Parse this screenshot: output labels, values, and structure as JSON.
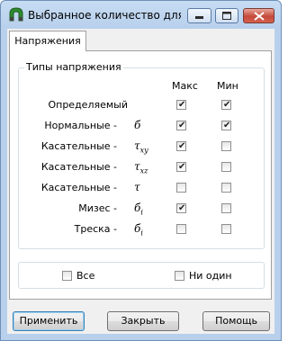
{
  "window": {
    "title": "Выбранное количество для п..."
  },
  "tabs": [
    {
      "label": "Напряжения"
    }
  ],
  "stress_group": {
    "title": "Типы напряжения",
    "col_max": "Макс",
    "col_min": "Мин",
    "rows": [
      {
        "label": "Определяемый",
        "symbol": "",
        "sub": "",
        "max": true,
        "min": true
      },
      {
        "label": "Нормальные -",
        "symbol": "б",
        "sub": "",
        "max": true,
        "min": true
      },
      {
        "label": "Касательные -",
        "symbol": "τ",
        "sub": "xy",
        "max": true,
        "min": false
      },
      {
        "label": "Касательные -",
        "symbol": "τ",
        "sub": "xz",
        "max": true,
        "min": false
      },
      {
        "label": "Касательные -",
        "symbol": "τ",
        "sub": "",
        "max": false,
        "min": false
      },
      {
        "label": "Мизес -",
        "symbol": "б",
        "sub": "i",
        "max": true,
        "min": false
      },
      {
        "label": "Треска -",
        "symbol": "б",
        "sub": "i",
        "max": false,
        "min": false
      }
    ]
  },
  "select_all": {
    "label": "Все",
    "checked": false
  },
  "select_none": {
    "label": "Ни один",
    "checked": false
  },
  "buttons": {
    "apply": "Применить",
    "close": "Закрыть",
    "help": "Помощь"
  }
}
